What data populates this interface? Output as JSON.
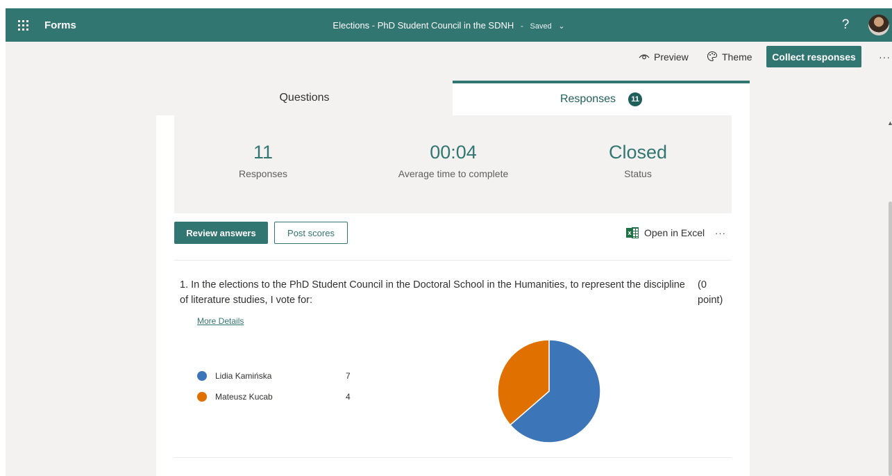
{
  "suite": {
    "app_name": "Forms",
    "doc_title": "Elections - PhD Student Council in the SDNH",
    "separator": "-",
    "save_status": "Saved",
    "help": "?"
  },
  "command_bar": {
    "preview_label": "Preview",
    "theme_label": "Theme",
    "collect_label": "Collect responses",
    "more": "···"
  },
  "tabs": {
    "questions_label": "Questions",
    "responses_label": "Responses",
    "responses_count": "11"
  },
  "summary": {
    "responses_value": "11",
    "responses_label": "Responses",
    "avg_time_value": "00:04",
    "avg_time_label": "Average time to complete",
    "status_value": "Closed",
    "status_label": "Status"
  },
  "actions": {
    "review_label": "Review answers",
    "post_scores_label": "Post scores",
    "open_excel_label": "Open in Excel",
    "more": "···"
  },
  "question": {
    "text": "1. In the elections to the PhD Student Council in the Doctoral School in the Humanities, to represent the discipline of literature studies, I vote for:",
    "points": "(0 point)",
    "more_details_label": "More Details"
  },
  "chart_data": {
    "type": "pie",
    "categories": [
      "Lidia Kamińska",
      "Mateusz Kucab"
    ],
    "values": [
      7,
      4
    ],
    "colors": [
      "#3d76b8",
      "#e07000"
    ]
  },
  "colors": {
    "brand": "#327672",
    "accent_dark": "#1f5f5b"
  }
}
